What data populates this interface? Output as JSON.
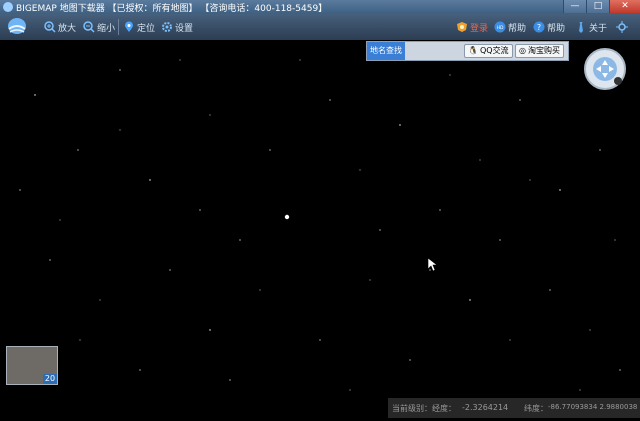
{
  "window": {
    "title": "BIGEMAP 地图下载器 【已授权：所有地图】 【咨询电话：400-118-5459】",
    "controls": [
      "—",
      "□",
      "✕"
    ]
  },
  "toolbar": {
    "left_tools": [
      {
        "icon": "zoom-in-icon",
        "label": "放大"
      },
      {
        "icon": "zoom-out-icon",
        "label": "缩小"
      },
      {
        "icon": "location-pin-icon",
        "label": "定位"
      },
      {
        "icon": "gear-icon",
        "label": "设置"
      }
    ],
    "right_tools": [
      {
        "icon": "vip-badge-icon",
        "label": "登录"
      },
      {
        "icon": "hd-icon",
        "label": "帮助"
      },
      {
        "icon": "help-icon",
        "label": "帮助"
      },
      {
        "icon": "tie-icon",
        "label": "关于"
      },
      {
        "icon": "more-icon",
        "label": ""
      }
    ]
  },
  "map_panel": {
    "search_tab": "地名查找",
    "qq_button": "QQ交流",
    "taobao_button": "淘宝购买"
  },
  "minimap": {
    "zoom_level": "20"
  },
  "statusbar": {
    "level_label": "当前级别：",
    "level_value": "",
    "longitude_label": "经度：",
    "longitude_value": "-2.3264214",
    "latitude_label": "纬度：",
    "latitude_value": "-86.77093834 2.9880038"
  },
  "colors": {
    "title_bar": "#3d5f82",
    "toolbar": "#2b3d52",
    "map_background": "#000000",
    "search_tab": "#3a7fd5"
  }
}
